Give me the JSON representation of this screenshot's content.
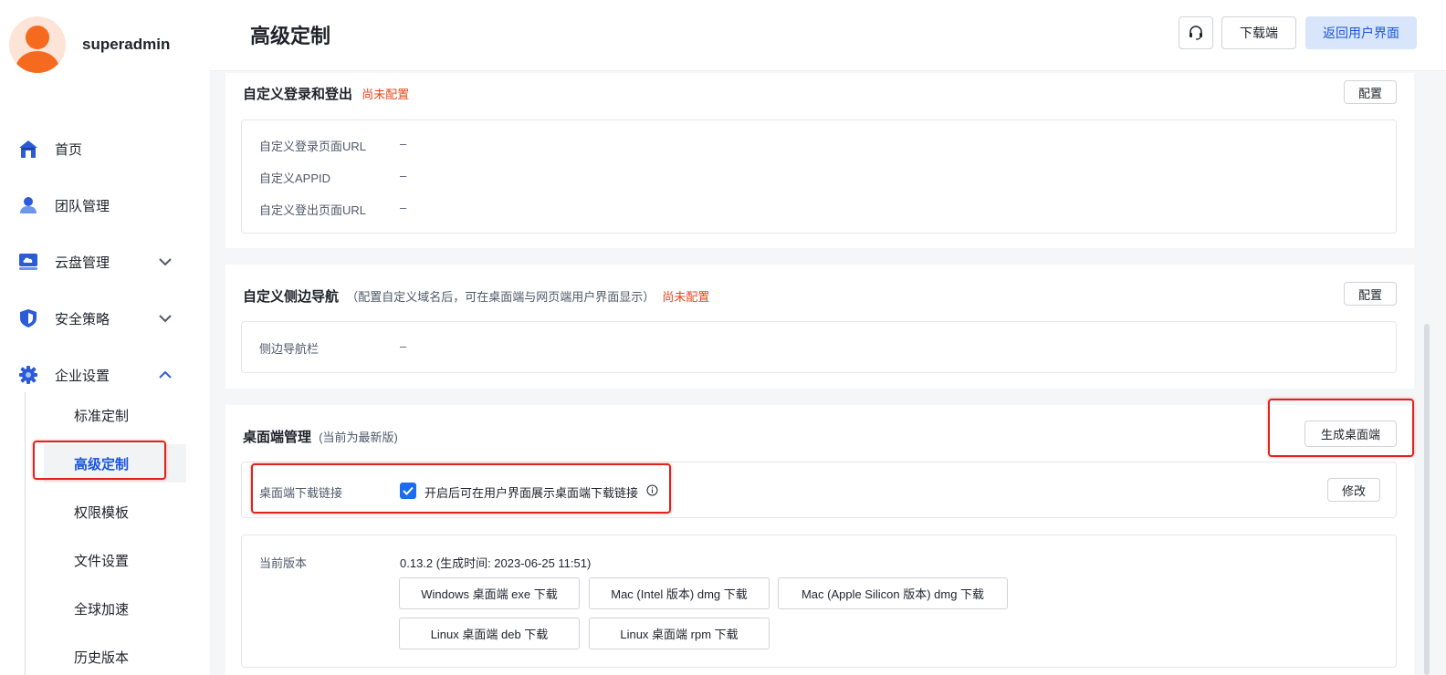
{
  "user": {
    "name": "superadmin"
  },
  "sidebar": {
    "items": [
      {
        "label": "首页",
        "icon": "home-icon"
      },
      {
        "label": "团队管理",
        "icon": "team-icon"
      },
      {
        "label": "云盘管理",
        "icon": "cloud-disk-icon",
        "expanded": false
      },
      {
        "label": "安全策略",
        "icon": "shield-icon",
        "expanded": false
      },
      {
        "label": "企业设置",
        "icon": "gear-icon",
        "expanded": true
      }
    ],
    "subitems": [
      {
        "label": "标准定制"
      },
      {
        "label": "高级定制",
        "active": true
      },
      {
        "label": "权限模板"
      },
      {
        "label": "文件设置"
      },
      {
        "label": "全球加速"
      },
      {
        "label": "历史版本"
      }
    ]
  },
  "header": {
    "title": "高级定制",
    "download_label": "下载端",
    "back_label": "返回用户界面"
  },
  "login_section": {
    "title": "自定义登录和登出",
    "status": "尚未配置",
    "config_label": "配置",
    "rows": [
      {
        "label": "自定义登录页面URL",
        "value": "–"
      },
      {
        "label": "自定义APPID",
        "value": "–"
      },
      {
        "label": "自定义登出页面URL",
        "value": "–"
      }
    ]
  },
  "sidenav_section": {
    "title": "自定义侧边导航",
    "note": "（配置自定义域名后，可在桌面端与网页端用户界面显示）",
    "status": "尚未配置",
    "config_label": "配置",
    "rows": [
      {
        "label": "侧边导航栏",
        "value": "–"
      }
    ]
  },
  "desktop_section": {
    "title": "桌面端管理",
    "note": "(当前为最新版)",
    "generate_label": "生成桌面端",
    "link_label": "桌面端下载链接",
    "checkbox_checked": true,
    "checkbox_text": "开启后可在用户界面展示桌面端下载链接",
    "edit_label": "修改",
    "version_label": "当前版本",
    "version_value": "0.13.2 (生成时间: 2023-06-25 11:51)",
    "downloads": [
      "Windows 桌面端 exe 下载",
      "Mac (Intel 版本) dmg 下载",
      "Mac (Apple Silicon 版本) dmg 下载",
      "Linux 桌面端 deb 下载",
      "Linux 桌面端 rpm 下载"
    ]
  },
  "colors": {
    "accent": "#1a56db",
    "warning": "#e5481a",
    "highlight": "#e0221c",
    "checkbox": "#1a6cf0"
  }
}
